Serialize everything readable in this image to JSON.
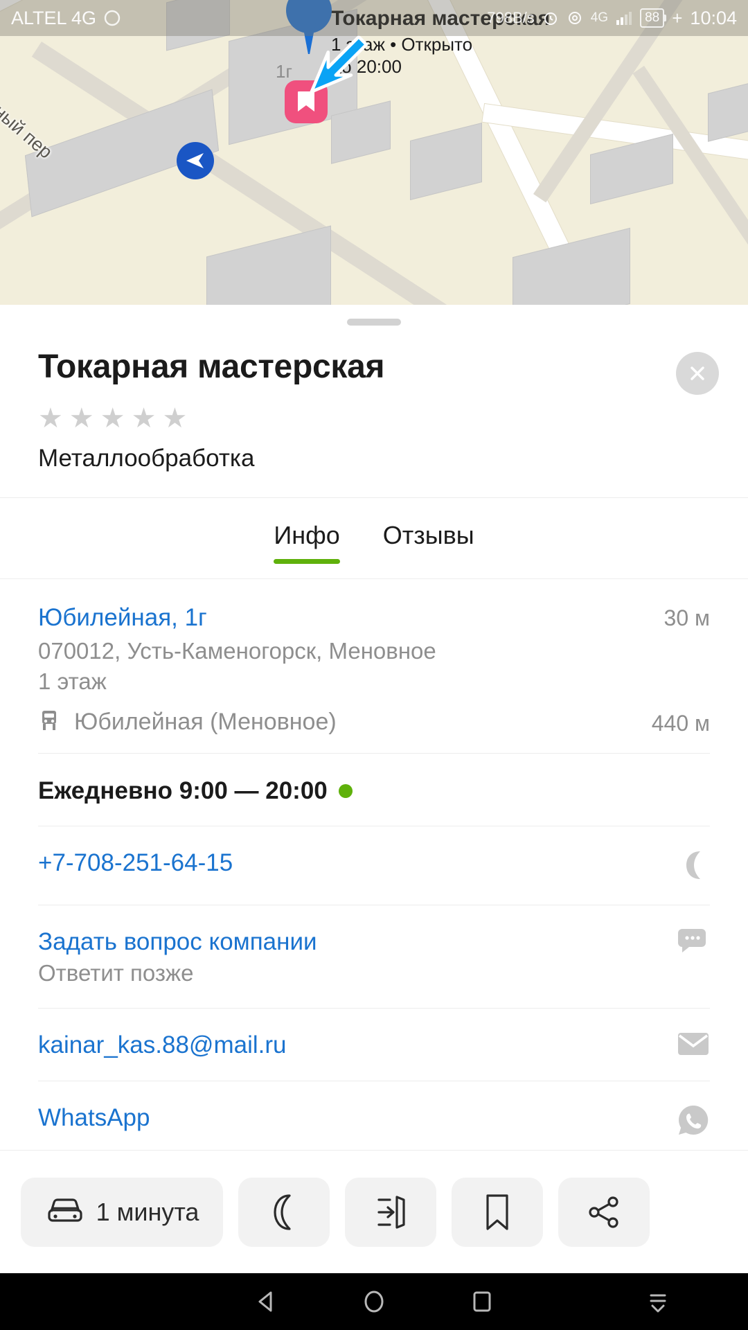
{
  "status_bar": {
    "carrier": "ALTEL 4G",
    "net_speed": "798B/s",
    "network": "4G",
    "battery_level": "88",
    "time": "10:04",
    "icons": [
      "alarm-icon",
      "camera-icon",
      "4g-icon",
      "signal-icon",
      "battery-icon"
    ]
  },
  "map": {
    "street_label": "вный пер",
    "house_number": "1г",
    "callout_title": "Токарная мастерская",
    "callout_subtitle": "1 этаж • Открыто до 20:00",
    "pin_color": "#1a6fd4",
    "favorite_marker_color": "#f0507e",
    "background_color": "#f2eedb"
  },
  "card": {
    "title": "Токарная мастерская",
    "rating_stars": 5,
    "rating_filled": 0,
    "category": "Металлообработка",
    "close_label": "✕",
    "tabs": [
      {
        "label": "Инфо",
        "active": true
      },
      {
        "label": "Отзывы",
        "active": false
      }
    ],
    "address": {
      "street": "Юбилейная, 1г",
      "city_line": "070012, Усть-Каменогорск, Меновное",
      "floor": "1 этаж",
      "distance": "30 м"
    },
    "transit": {
      "icon": "bus-stop-icon",
      "name": "Юбилейная (Меновное)",
      "distance": "440 м"
    },
    "hours": {
      "text": "Ежедневно 9:00 — 20:00",
      "status_color": "#5fb10b"
    },
    "phone": {
      "number": "+7-708-251-64-15",
      "icon": "phone-icon"
    },
    "ask": {
      "title": "Задать вопрос компании",
      "subtitle": "Ответит позже",
      "icon": "chat-bubbles-icon"
    },
    "email": {
      "address": "kainar_kas.88@mail.ru",
      "icon": "envelope-icon"
    },
    "whatsapp": {
      "label": "WhatsApp",
      "icon": "whatsapp-icon"
    },
    "link_color": "#1a73cf",
    "accent_color": "#5fb10b"
  },
  "action_bar": {
    "route": {
      "label": "1 минута",
      "icon": "car-icon"
    },
    "call": {
      "icon": "phone-handset-icon"
    },
    "entrance": {
      "icon": "entrance-icon"
    },
    "bookmark": {
      "icon": "bookmark-icon"
    },
    "share": {
      "icon": "share-icon"
    }
  },
  "android_nav": {
    "back": "back-triangle-icon",
    "home": "home-circle-icon",
    "recents": "recents-square-icon",
    "hide": "hide-nav-icon"
  }
}
